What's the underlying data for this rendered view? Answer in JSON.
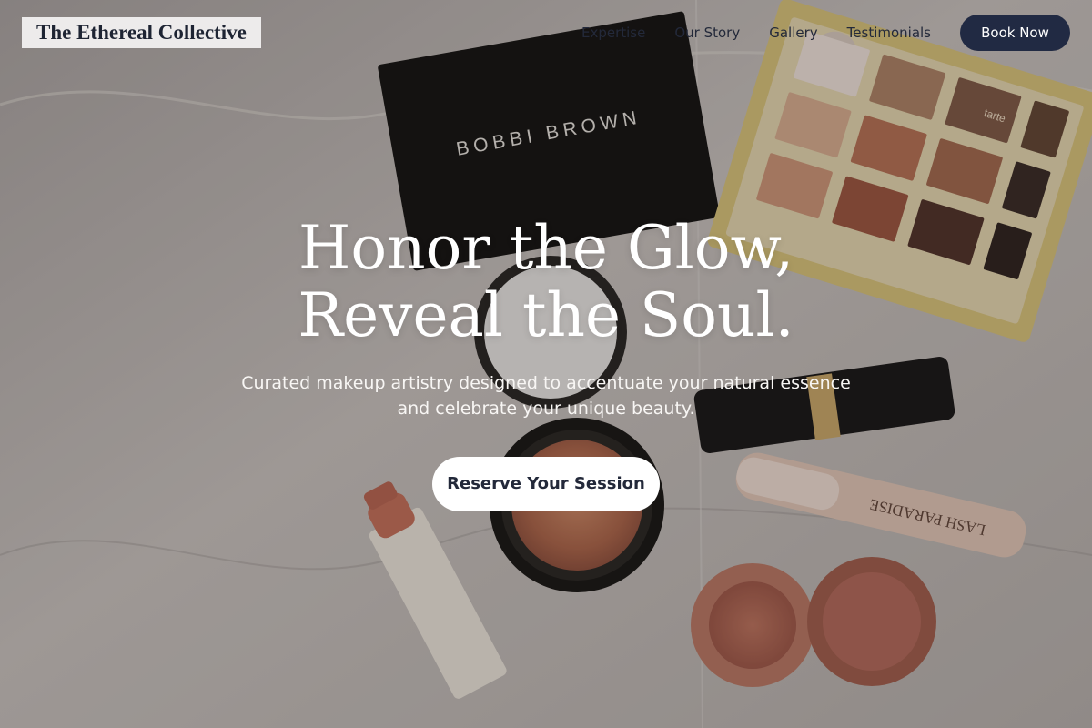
{
  "brand": {
    "name": "The Ethereal Collective"
  },
  "nav": {
    "links": [
      {
        "label": "Expertise"
      },
      {
        "label": "Our Story"
      },
      {
        "label": "Gallery"
      },
      {
        "label": "Testimonials"
      }
    ],
    "cta_label": "Book Now"
  },
  "hero": {
    "headline_line1": "Honor the Glow,",
    "headline_line2": "Reveal the Soul.",
    "subheadline": "Curated makeup artistry designed to accentuate your natural essence and celebrate your unique beauty.",
    "cta_label": "Reserve Your Session"
  },
  "products": {
    "compact_brand": "BOBBI BROWN",
    "mascara_brand": "LASH PARADISE",
    "palette_brand": "tarte"
  },
  "colors": {
    "navy": "#212a43",
    "white": "#ffffff",
    "text_dark": "#1e2433"
  }
}
